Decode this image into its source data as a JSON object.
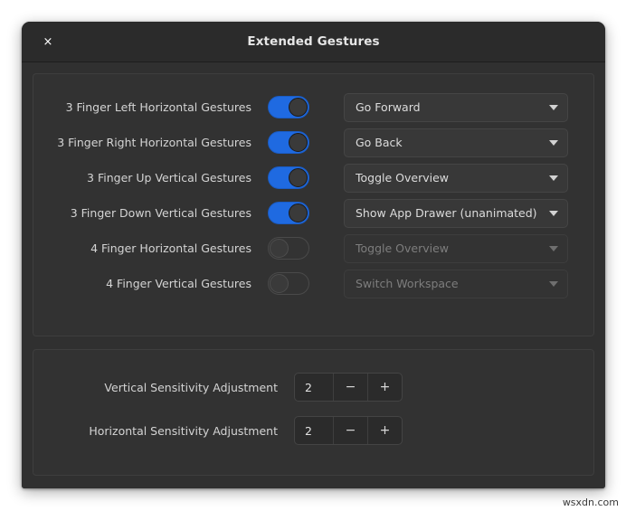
{
  "window": {
    "title": "Extended Gestures",
    "close_label": "×"
  },
  "gesture_section": {
    "rows": [
      {
        "label": "3 Finger Left Horizontal Gestures",
        "toggle_state": "on",
        "action": "Go Forward",
        "action_enabled": true
      },
      {
        "label": "3 Finger Right Horizontal Gestures",
        "toggle_state": "on",
        "action": "Go Back",
        "action_enabled": true
      },
      {
        "label": "3 Finger Up Vertical Gestures",
        "toggle_state": "on",
        "action": "Toggle Overview",
        "action_enabled": true
      },
      {
        "label": "3 Finger Down Vertical Gestures",
        "toggle_state": "on",
        "action": "Show App Drawer (unanimated)",
        "action_enabled": true
      },
      {
        "label": "4 Finger Horizontal Gestures",
        "toggle_state": "off",
        "action": "Toggle Overview",
        "action_enabled": false
      },
      {
        "label": "4 Finger Vertical Gestures",
        "toggle_state": "off",
        "action": "Switch Workspace",
        "action_enabled": false
      }
    ]
  },
  "sensitivity_section": {
    "rows": [
      {
        "label": "Vertical Sensitivity Adjustment",
        "value": "2",
        "decrement_label": "−",
        "increment_label": "+"
      },
      {
        "label": "Horizontal Sensitivity Adjustment",
        "value": "2",
        "decrement_label": "−",
        "increment_label": "+"
      }
    ]
  },
  "watermark": "wsxdn.com",
  "colors": {
    "accent": "#1f6ae1",
    "window_bg": "#303030",
    "titlebar_bg": "#2b2b2b",
    "frame_bg": "#323232",
    "text": "#d4d4d4",
    "text_disabled": "#7d7d7d"
  }
}
